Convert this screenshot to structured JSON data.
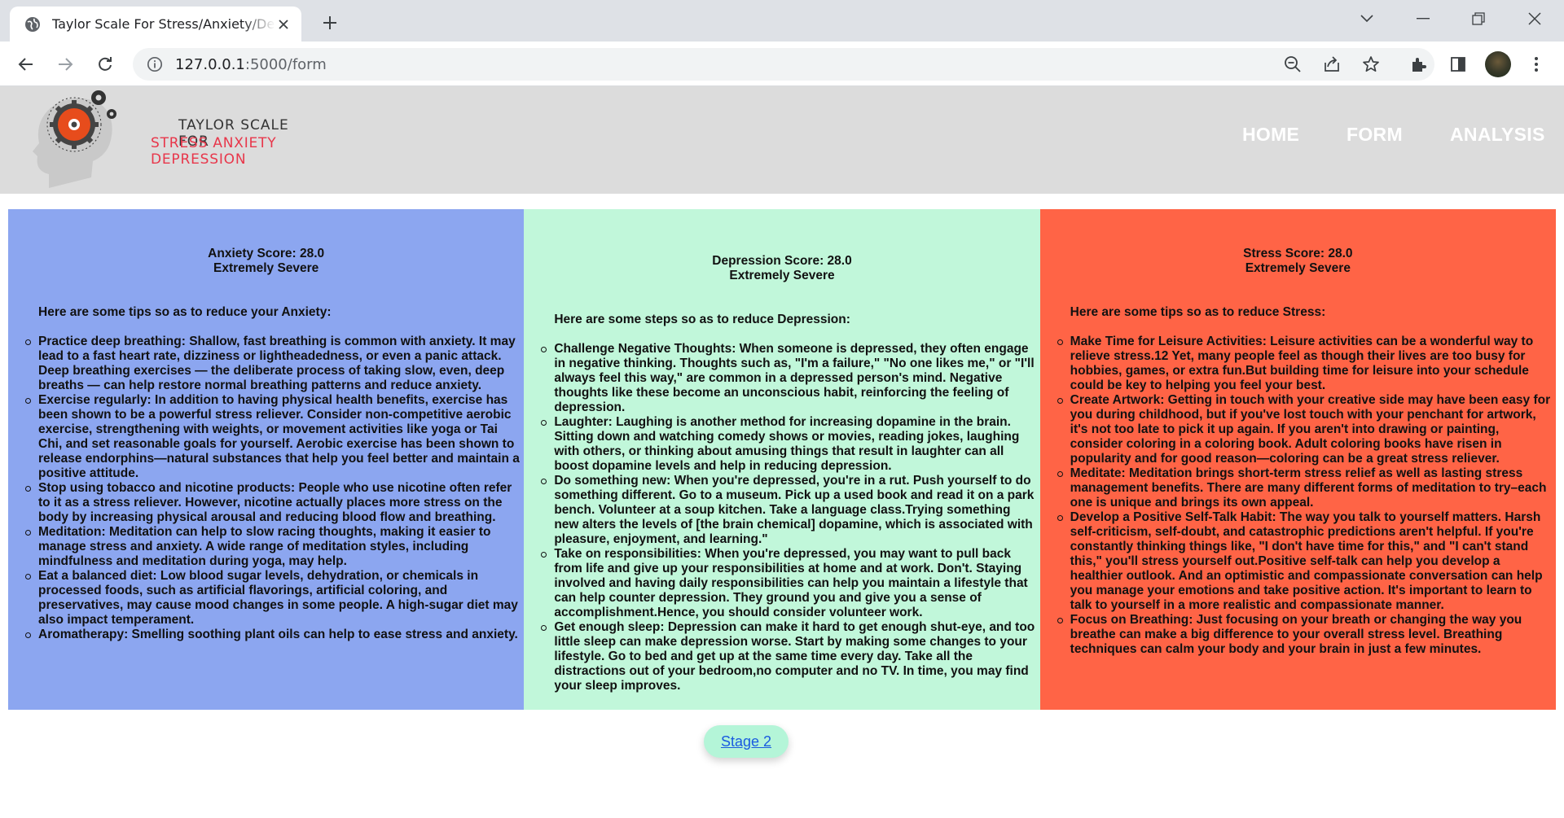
{
  "browser": {
    "tab_title": "Taylor Scale For Stress/Anxiety/Depression",
    "url_host": "127.0.0.1",
    "url_rest": ":5000/form"
  },
  "site": {
    "logo_line1": "TAYLOR SCALE FOR",
    "logo_line2": "STRESS ANXIETY DEPRESSION",
    "nav": [
      "HOME",
      "FORM",
      "ANALYSIS"
    ]
  },
  "panels": {
    "anxiety": {
      "score_label": "Anxiety Score: 28.0",
      "severity": "Extremely Severe",
      "heading": "Here are some tips so as to reduce your Anxiety:",
      "tips": [
        "Practice deep breathing: Shallow, fast breathing is common with anxiety. It may lead to a fast heart rate, dizziness or lightheadedness, or even a panic attack. Deep breathing exercises — the deliberate process of taking slow, even, deep breaths — can help restore normal breathing patterns and reduce anxiety.",
        "Exercise regularly: In addition to having physical health benefits, exercise has been shown to be a powerful stress reliever. Consider non-competitive aerobic exercise, strengthening with weights, or movement activities like yoga or Tai Chi, and set reasonable goals for yourself. Aerobic exercise has been shown to release endorphins—natural substances that help you feel better and maintain a positive attitude.",
        "Stop using tobacco and nicotine products: People who use nicotine often refer to it as a stress reliever. However, nicotine actually places more stress on the body by increasing physical arousal and reducing blood flow and breathing.",
        "Meditation: Meditation can help to slow racing thoughts, making it easier to manage stress and anxiety. A wide range of meditation styles, including mindfulness and meditation during yoga, may help.",
        "Eat a balanced diet: Low blood sugar levels, dehydration, or chemicals in processed foods, such as artificial flavorings, artificial coloring, and preservatives, may cause mood changes in some people. A high-sugar diet may also impact temperament.",
        "Aromatherapy: Smelling soothing plant oils can help to ease stress and anxiety."
      ]
    },
    "depression": {
      "score_label": "Depression Score: 28.0",
      "severity": "Extremely Severe",
      "heading": "Here are some steps so as to reduce Depression:",
      "tips": [
        "Challenge Negative Thoughts: When someone is depressed, they often engage in negative thinking. Thoughts such as, \"I'm a failure,\" \"No one likes me,\" or \"I'll always feel this way,\" are common in a depressed person's mind. Negative thoughts like these become an unconscious habit, reinforcing the feeling of depression.",
        "Laughter: Laughing is another method for increasing dopamine in the brain. Sitting down and watching comedy shows or movies, reading jokes, laughing with others, or thinking about amusing things that result in laughter can all boost dopamine levels and help in reducing depression.",
        "Do something new: When you're depressed, you're in a rut. Push yourself to do something different. Go to a museum. Pick up a used book and read it on a park bench. Volunteer at a soup kitchen. Take a language class.Trying something new alters the levels of [the brain chemical] dopamine, which is associated with pleasure, enjoyment, and learning.\"",
        "Take on responsibilities: When you're depressed, you may want to pull back from life and give up your responsibilities at home and at work. Don't. Staying involved and having daily responsibilities can help you maintain a lifestyle that can help counter depression. They ground you and give you a sense of accomplishment.Hence, you should consider volunteer work.",
        "Get enough sleep: Depression can make it hard to get enough shut-eye, and too little sleep can make depression worse. Start by making some changes to your lifestyle. Go to bed and get up at the same time every day. Take all the distractions out of your bedroom,no computer and no TV. In time, you may find your sleep improves."
      ]
    },
    "stress": {
      "score_label": "Stress Score: 28.0",
      "severity": "Extremely Severe",
      "heading": "Here are some tips so as to reduce Stress:",
      "tips": [
        "Make Time for Leisure Activities: Leisure activities can be a wonderful way to relieve stress.12 Yet, many people feel as though their lives are too busy for hobbies, games, or extra fun.But building time for leisure into your schedule could be key to helping you feel your best.",
        "Create Artwork: Getting in touch with your creative side may have been easy for you during childhood, but if you've lost touch with your penchant for artwork, it's not too late to pick it up again. If you aren't into drawing or painting, consider coloring in a coloring book. Adult coloring books have risen in popularity and for good reason—coloring can be a great stress reliever.",
        "Meditate: Meditation brings short-term stress relief as well as lasting stress management benefits. There are many different forms of meditation to try–each one is unique and brings its own appeal.",
        "Develop a Positive Self-Talk Habit: The way you talk to yourself matters. Harsh self-criticism, self-doubt, and catastrophic predictions aren't helpful. If you're constantly thinking things like, \"I don't have time for this,\" and \"I can't stand this,\" you'll stress yourself out.Positive self-talk can help you develop a healthier outlook. And an optimistic and compassionate conversation can help you manage your emotions and take positive action. It's important to learn to talk to yourself in a more realistic and compassionate manner.",
        "Focus on Breathing: Just focusing on your breath or changing the way you breathe can make a big difference to your overall stress level. Breathing techniques can calm your body and your brain in just a few minutes."
      ]
    }
  },
  "stage_button": "Stage 2",
  "colors": {
    "anxiety_panel": "#8ca6f0",
    "depression_panel": "#c1f7da",
    "stress_panel": "#ff6446",
    "header_bg": "#dcdcdc",
    "logo_accent": "#e8364a",
    "button_bg": "#b4f5d8"
  }
}
